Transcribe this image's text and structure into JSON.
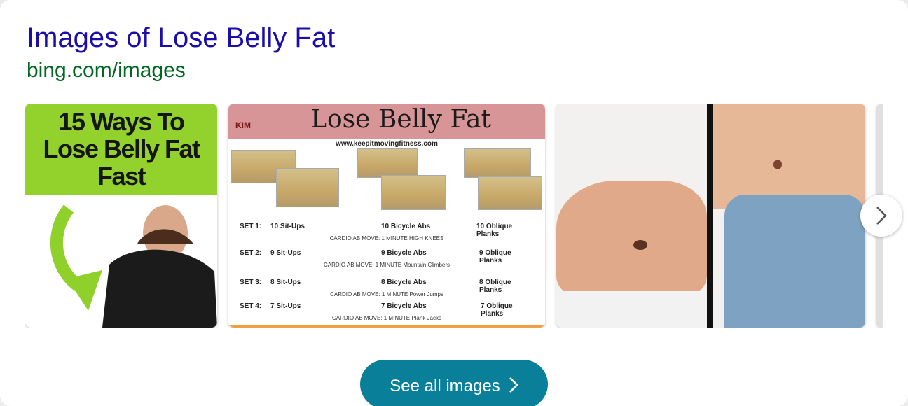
{
  "result": {
    "title": "Images of Lose Belly Fat",
    "url": "bing.com/images"
  },
  "thumbnails": [
    {
      "alt_text_lines": [
        "15 Ways To",
        "Lose Belly Fat",
        "Fast"
      ]
    },
    {
      "heading": "Lose Belly Fat",
      "logo": "KIM",
      "site": "www.keepitmovingfitness.com",
      "sets": [
        {
          "label": "SET 1:",
          "situps": "10 Sit-Ups",
          "bicycle": "10 Bicycle Abs",
          "planks": "10 Oblique Planks",
          "cardio": "CARDIO AB MOVE: 1 MINUTE  HIGH KNEES"
        },
        {
          "label": "SET 2:",
          "situps": "9 Sit-Ups",
          "bicycle": "9 Bicycle Abs",
          "planks": "9 Oblique Planks",
          "cardio": "CARDIO AB MOVE: 1 MINUTE  Mountain Climbers"
        },
        {
          "label": "SET 3:",
          "situps": "8 Sit-Ups",
          "bicycle": "8 Bicycle Abs",
          "planks": "8 Oblique Planks",
          "cardio": "CARDIO AB MOVE: 1 MINUTE  Power Jumps"
        },
        {
          "label": "SET 4:",
          "situps": "7 Sit-Ups",
          "bicycle": "7 Bicycle Abs",
          "planks": "7 Oblique Planks",
          "cardio": "CARDIO AB MOVE: 1 MINUTE  Plank Jacks"
        }
      ]
    },
    {},
    {}
  ],
  "actions": {
    "see_all_label": "See all images"
  },
  "icons": {
    "next": "chevron-right-icon",
    "see_all_chevron": "chevron-right-icon"
  },
  "colors": {
    "title": "#1a0dab",
    "url": "#006621",
    "button": "#0a7f9a"
  }
}
